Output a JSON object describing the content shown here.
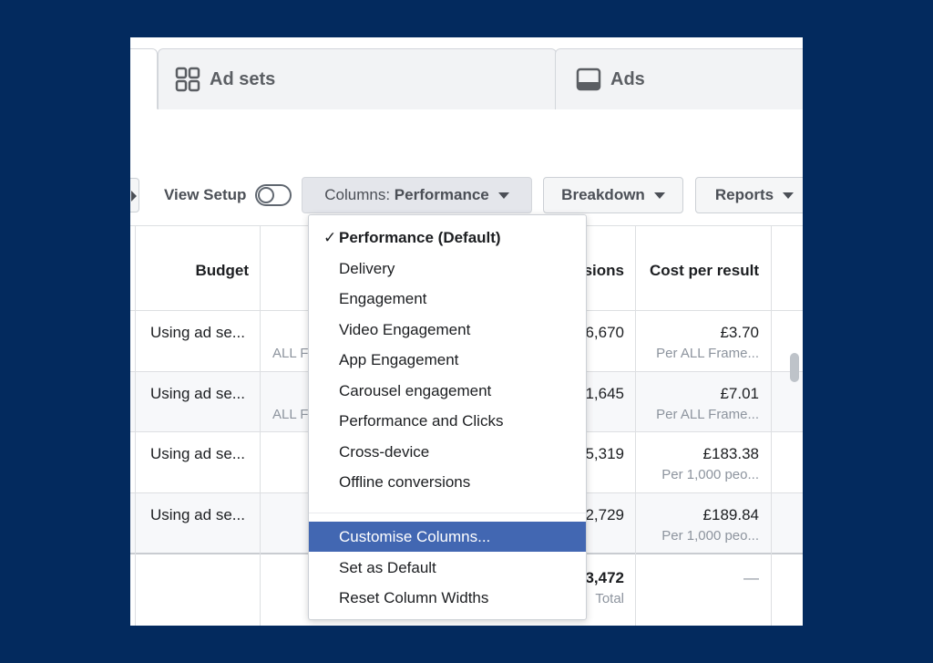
{
  "tabs": {
    "ad_sets": "Ad sets",
    "ads": "Ads"
  },
  "toolbar": {
    "view_setup_label": "View Setup",
    "columns_prefix": "Columns:",
    "columns_value": "Performance",
    "breakdown_label": "Breakdown",
    "reports_label": "Reports"
  },
  "table": {
    "headers": {
      "budget": "Budget",
      "impressions_partial": "sions",
      "cost_per_result": "Cost per result"
    },
    "rows": [
      {
        "budget": "Using ad se...",
        "mid_sub": "ALL F",
        "impressions": "6,670",
        "cost": "£3.70",
        "cost_sub": "Per ALL Frame..."
      },
      {
        "budget": "Using ad se...",
        "mid_sub": "ALL F",
        "impressions": "1,645",
        "cost": "£7.01",
        "cost_sub": "Per ALL Frame..."
      },
      {
        "budget": "Using ad se...",
        "mid_sub": "",
        "impressions": "5,319",
        "cost": "£183.38",
        "cost_sub": "Per 1,000 peo..."
      },
      {
        "budget": "Using ad se...",
        "mid_sub": "",
        "impressions": "2,729",
        "cost": "£189.84",
        "cost_sub": "Per 1,000 peo..."
      }
    ],
    "total": {
      "impressions": "3,472",
      "impressions_sub": "Total",
      "cost": "—"
    }
  },
  "dropdown": {
    "checkmark": "✓",
    "items": [
      "Performance (Default)",
      "Delivery",
      "Engagement",
      "Video Engagement",
      "App Engagement",
      "Carousel engagement",
      "Performance and Clicks",
      "Cross-device",
      "Offline conversions"
    ],
    "actions": [
      "Customise Columns...",
      "Set as Default",
      "Reset Column Widths"
    ]
  },
  "colors": {
    "background": "#032a5e",
    "highlight": "#4267b2"
  },
  "icons": {
    "ad_sets_tab": "grid-icon",
    "ads_tab": "monitor-icon"
  }
}
